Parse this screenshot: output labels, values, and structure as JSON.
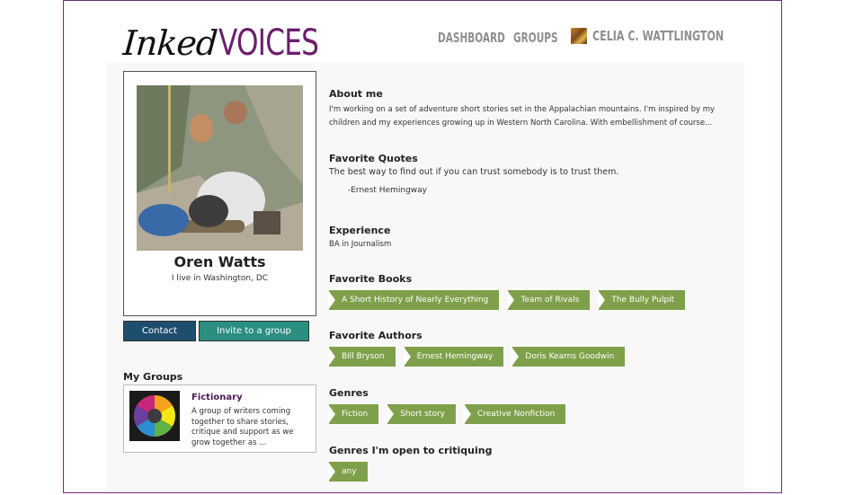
{
  "header": {
    "logo_inked": "Inked",
    "logo_voices": "VOICES",
    "nav": {
      "dashboard": "DASHBOARD",
      "groups": "GROUPS",
      "user_name": "CELIA C. WATTLINGTON"
    }
  },
  "profile": {
    "name": "Oren Watts",
    "location": "I live in Washington, DC",
    "contact_label": "Contact",
    "invite_label": "Invite to a group"
  },
  "groups": {
    "heading": "My Groups",
    "items": [
      {
        "title": "Fictionary",
        "description": "A group of writers coming together to share stories, critique and support as we grow together as ..."
      }
    ]
  },
  "about": {
    "heading": "About me",
    "text": "I'm working on a set of adventure short stories set in the Appalachian mountains. I'm inspired by my children and my experiences growing up in Western North Carolina. With embellishment of course..."
  },
  "quotes": {
    "heading": "Favorite Quotes",
    "text": "The best way to find out if you can trust somebody is to trust them.",
    "attribution": "-Ernest Hemingway"
  },
  "experience": {
    "heading": "Experience",
    "text": "BA in Journalism"
  },
  "books": {
    "heading": "Favorite Books",
    "tags": [
      "A Short History of Nearly Everything",
      "Team of Rivals",
      "The Bully Pulpit"
    ]
  },
  "authors": {
    "heading": "Favorite Authors",
    "tags": [
      "Bill Bryson",
      "Ernest Hemingway",
      "Doris Kearns Goodwin"
    ]
  },
  "genres": {
    "heading": "Genres",
    "tags": [
      "Fiction",
      "Short story",
      "Creative Nonfiction"
    ]
  },
  "critiquing": {
    "heading": "Genres I'm open to critiquing",
    "tags": [
      "any"
    ]
  },
  "colors": {
    "brand_purple": "#6a1f6a",
    "tag_green": "#7fa04a",
    "contact_blue": "#1e4e6e",
    "invite_teal": "#2a8f80",
    "nav_gray": "#8f8f8f"
  }
}
